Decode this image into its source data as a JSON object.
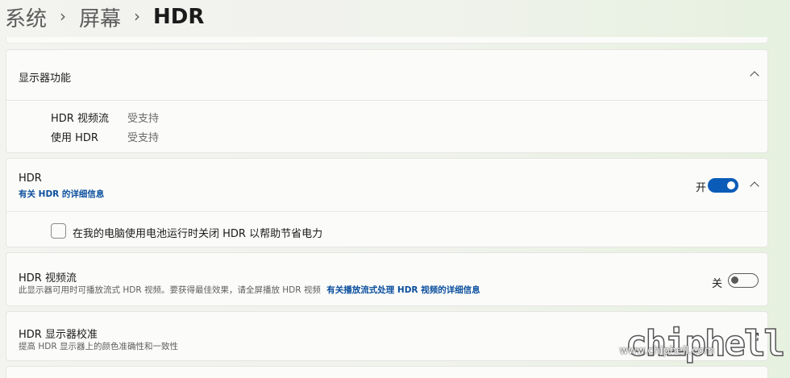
{
  "breadcrumb": {
    "items": [
      "系统",
      "屏幕",
      "HDR"
    ],
    "separator": "›"
  },
  "display_features": {
    "title": "显示器功能",
    "rows": [
      {
        "key": "HDR 视频流",
        "value": "受支持"
      },
      {
        "key": "使用 HDR",
        "value": "受支持"
      }
    ]
  },
  "hdr": {
    "title": "HDR",
    "link": "有关 HDR 的详细信息",
    "toggle_label": "开",
    "toggle_state": "on",
    "battery_option": "在我的电脑使用电池运行时关闭 HDR 以帮助节省电力"
  },
  "hdr_video": {
    "title": "HDR 视频流",
    "description": "此显示器可用时可播放流式 HDR 视频。要获得最佳效果，请全屏播放 HDR 视频",
    "link": "有关播放流式处理 HDR 视频的详细信息",
    "toggle_label": "关",
    "toggle_state": "off"
  },
  "calibration": {
    "title": "HDR 显示器校准",
    "description": "提高 HDR 显示器上的颜色准确性和一致性"
  },
  "watermark": {
    "logo_text": "chiphell",
    "url": "www.chiphell.com"
  },
  "colors": {
    "accent": "#0a5cb8",
    "link": "#0b4f9e"
  }
}
